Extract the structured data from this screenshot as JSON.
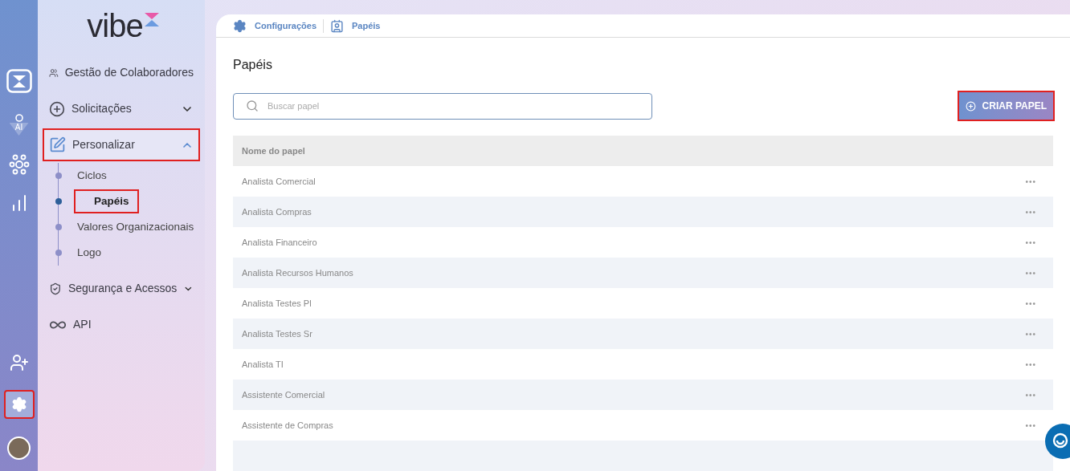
{
  "rail": {
    "top": [
      {
        "kind": "logo"
      },
      {
        "kind": "ai",
        "label": "AI"
      },
      {
        "kind": "network"
      },
      {
        "kind": "chart"
      }
    ],
    "bottom": [
      {
        "kind": "add-user"
      },
      {
        "kind": "settings",
        "selected": true,
        "highlighted": true
      },
      {
        "kind": "avatar"
      }
    ]
  },
  "sidebar": {
    "logo": "vibe",
    "items": [
      {
        "label": "Gestão de Colaboradores",
        "highlighted": false
      },
      {
        "label": "Solicitações",
        "expanded": false,
        "highlighted": false
      },
      {
        "label": "Personalizar",
        "expanded": true,
        "highlighted": true,
        "children": [
          {
            "label": "Ciclos",
            "selected": false,
            "highlighted": false
          },
          {
            "label": "Papéis",
            "selected": true,
            "highlighted": true
          },
          {
            "label": "Valores Organizacionais",
            "selected": false,
            "highlighted": false
          },
          {
            "label": "Logo",
            "selected": false,
            "highlighted": false
          }
        ]
      },
      {
        "label": "Segurança e Acessos",
        "expanded": false,
        "highlighted": false
      },
      {
        "label": "API",
        "highlighted": false
      }
    ]
  },
  "breadcrumb": [
    {
      "label": "Configurações"
    },
    {
      "label": "Papéis"
    }
  ],
  "page": {
    "title": "Papéis",
    "search": {
      "placeholder": "Buscar papel"
    },
    "create_button": {
      "label": "CRIAR PAPEL",
      "highlighted": true
    }
  },
  "table": {
    "columns": [
      "Nome do papel"
    ],
    "rows": [
      {
        "name": "Analista Comercial",
        "menu": "•••"
      },
      {
        "name": "Analista Compras",
        "menu": "•••"
      },
      {
        "name": "Analista Financeiro",
        "menu": "•••"
      },
      {
        "name": "Analista Recursos Humanos",
        "menu": "•••"
      },
      {
        "name": "Analista Testes Pl",
        "menu": "•••"
      },
      {
        "name": "Analista Testes Sr",
        "menu": "•••"
      },
      {
        "name": "Analista TI",
        "menu": "•••"
      },
      {
        "name": "Assistente Comercial",
        "menu": "•••"
      },
      {
        "name": "Assistente de Compras",
        "menu": "•••"
      }
    ]
  }
}
